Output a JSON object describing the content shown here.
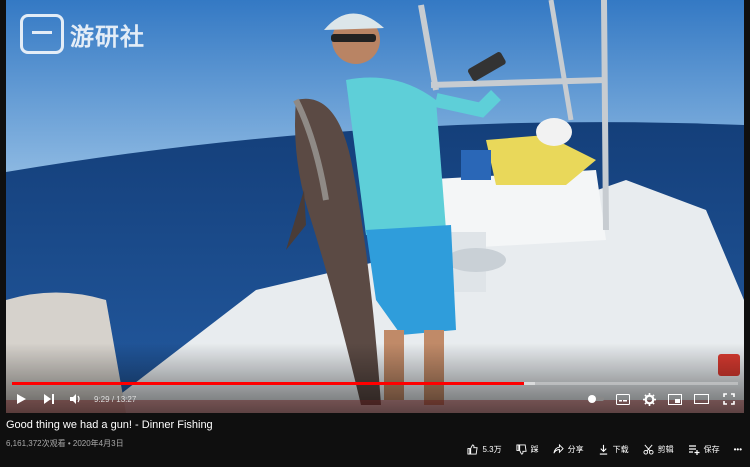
{
  "player": {
    "watermark_text": "游研社",
    "badge_text": "",
    "time_current": "9:29",
    "time_separator": "/",
    "time_total": "13:27",
    "progress": 0.705,
    "buffered": 0.72
  },
  "video": {
    "title": "Good thing we had a gun! - Dinner Fishing",
    "views": "6,161,372次观看",
    "dot": "•",
    "date": "2020年4月3日"
  },
  "actions": {
    "like_count": "5.3万",
    "dislike_label": "踩",
    "share_label": "分享",
    "download_label": "下载",
    "clip_label": "剪辑",
    "save_label": "保存",
    "more_label": "•••"
  },
  "colors": {
    "accent": "#ff0000",
    "sky": "#2f6fb6",
    "sea": "#1b4d86"
  }
}
